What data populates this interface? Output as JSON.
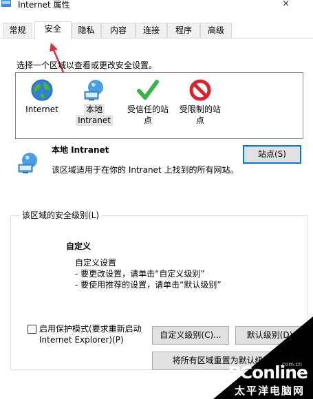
{
  "window": {
    "title": "Internet 属性",
    "close_glyph": "×"
  },
  "tabs": [
    {
      "label": "常规",
      "active": false
    },
    {
      "label": "安全",
      "active": true
    },
    {
      "label": "隐私",
      "active": false
    },
    {
      "label": "内容",
      "active": false
    },
    {
      "label": "连接",
      "active": false
    },
    {
      "label": "程序",
      "active": false
    },
    {
      "label": "高级",
      "active": false
    }
  ],
  "security": {
    "intro": "选择一个区域以查看或更改安全设置。",
    "zones": [
      {
        "line1": "Internet",
        "line2": "",
        "icon": "globe-icon",
        "selected": false
      },
      {
        "line1": "本地",
        "line2": "Intranet",
        "icon": "intranet-globe-icon",
        "selected": true
      },
      {
        "line1": "受信任的站",
        "line2": "点",
        "icon": "checkmark-icon",
        "selected": false
      },
      {
        "line1": "受限制的站",
        "line2": "点",
        "icon": "restricted-icon",
        "selected": false
      }
    ],
    "selected_zone": {
      "title": "本地 Intranet",
      "description": "该区域适用于在你的 Intranet 上找到的所有网站。",
      "sites_button": "站点(S)"
    },
    "level_group": {
      "legend": "该区域的安全级别(L)",
      "custom_title": "自定义",
      "custom_lines": [
        "自定义设置",
        "- 要更改设置，请单击“自定义级别”",
        "- 要使用推荐的设置，请单击“默认级别”"
      ],
      "protected_mode_label_line1": "启用保护模式(要求重新启动",
      "protected_mode_label_line2": "Internet Explorer)(P)",
      "protected_mode_checked": false,
      "custom_level_button": "自定义级别(C)...",
      "default_level_button": "默认级别(D)",
      "reset_all_button": "将所有区域重置为默认级别(R)"
    }
  },
  "watermark": {
    "brand": "PConline",
    "brand_suffix": ".com.cn",
    "subtitle": "太平洋电脑网"
  },
  "colors": {
    "accent": "#0078d7",
    "arrow": "#d8343e",
    "restricted": "#d9232f",
    "trusted": "#37b34a"
  }
}
